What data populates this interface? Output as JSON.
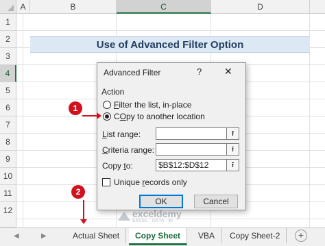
{
  "columns": [
    {
      "label": "A",
      "selected": false
    },
    {
      "label": "B",
      "selected": false
    },
    {
      "label": "C",
      "selected": true
    },
    {
      "label": "D",
      "selected": false
    }
  ],
  "rows": [
    {
      "label": "1",
      "selected": false
    },
    {
      "label": "2",
      "selected": false
    },
    {
      "label": "3",
      "selected": false
    },
    {
      "label": "4",
      "selected": true
    },
    {
      "label": "5",
      "selected": false
    },
    {
      "label": "6",
      "selected": false
    },
    {
      "label": "7",
      "selected": false
    },
    {
      "label": "8",
      "selected": false
    },
    {
      "label": "9",
      "selected": false
    },
    {
      "label": "10",
      "selected": false
    },
    {
      "label": "11",
      "selected": false
    },
    {
      "label": "12",
      "selected": false
    }
  ],
  "sheet": {
    "title": "Use of Advanced Filter Option"
  },
  "dialog": {
    "title": "Advanced Filter",
    "help": "?",
    "close": "✕",
    "action_label": "Action",
    "options": [
      {
        "accel": "F",
        "rest": "ilter the list, in-place",
        "checked": false
      },
      {
        "accel": "O",
        "rest": "py to another location",
        "prefix": "C",
        "checked": true
      }
    ],
    "list_range": {
      "label_accel": "L",
      "label_rest": "ist range:",
      "value": ""
    },
    "criteria_range": {
      "label_accel": "C",
      "label_rest": "riteria range:",
      "value": ""
    },
    "copy_to": {
      "label_pre": "Copy ",
      "label_accel": "t",
      "label_rest": "o:",
      "value": "$B$12:$D$12"
    },
    "range_button": "⭱",
    "unique": {
      "label_pre": "Unique ",
      "label_accel": "r",
      "label_rest": "ecords only",
      "checked": false
    },
    "ok": "OK",
    "cancel": "Cancel"
  },
  "annotations": {
    "badge1": "1",
    "badge2": "2"
  },
  "tabs": {
    "nav_prev": "◀",
    "nav_next": "▶",
    "items": [
      {
        "label": "Actual Sheet",
        "active": false
      },
      {
        "label": "Copy Sheet",
        "active": true
      },
      {
        "label": "VBA",
        "active": false
      },
      {
        "label": "Copy Sheet-2",
        "active": false
      }
    ],
    "add": "+"
  },
  "watermark": {
    "name": "exceldemy",
    "tagline": "EXCEL · DATA · BI"
  },
  "colors": {
    "accent_green": "#217346",
    "badge_red": "#d0121d",
    "title_fill": "#dce9f5",
    "ok_focus": "#0078d7"
  }
}
